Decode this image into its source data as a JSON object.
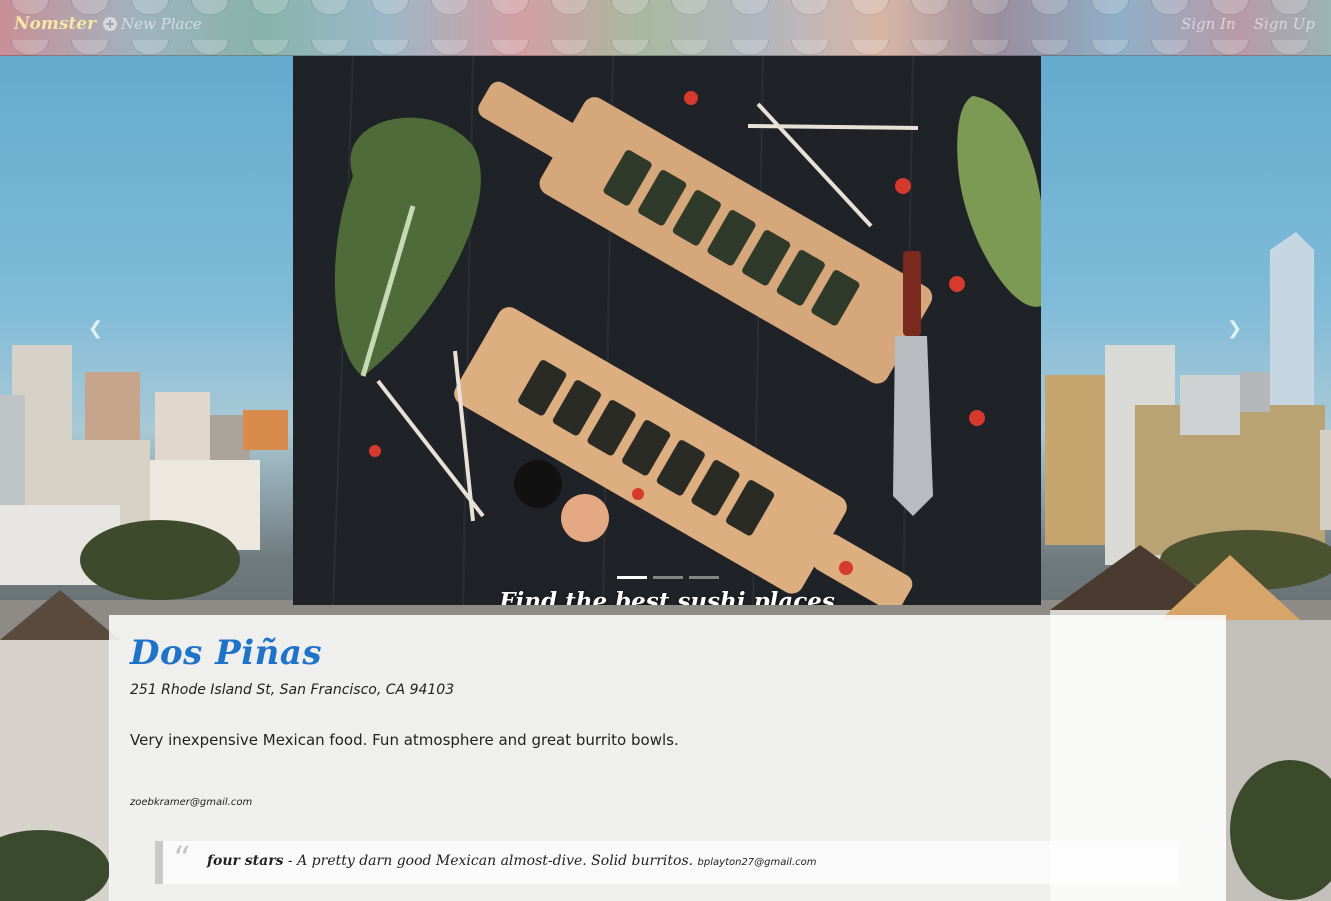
{
  "nav": {
    "brand": "Nomster",
    "new_place": "New Place",
    "sign_in": "Sign In",
    "sign_up": "Sign Up"
  },
  "carousel": {
    "caption": "Find the best sushi places",
    "slides": 3,
    "active_slide": 1,
    "prev_icon": "chevron-left-icon",
    "next_icon": "chevron-right-icon"
  },
  "place": {
    "name": "Dos Piñas",
    "address": "251 Rhode Island St, San Francisco, CA 94103",
    "description": "Very inexpensive Mexican food. Fun atmosphere and great burrito bowls.",
    "owner_email": "zoebkramer@gmail.com"
  },
  "review": {
    "rating": "four stars",
    "separator": " - ",
    "comment": "A pretty darn good Mexican almost-dive. Solid burritos.",
    "email": "bplayton27@gmail.com"
  },
  "colors": {
    "brand": "#f7e6a6",
    "place_name": "#1f73c8"
  }
}
